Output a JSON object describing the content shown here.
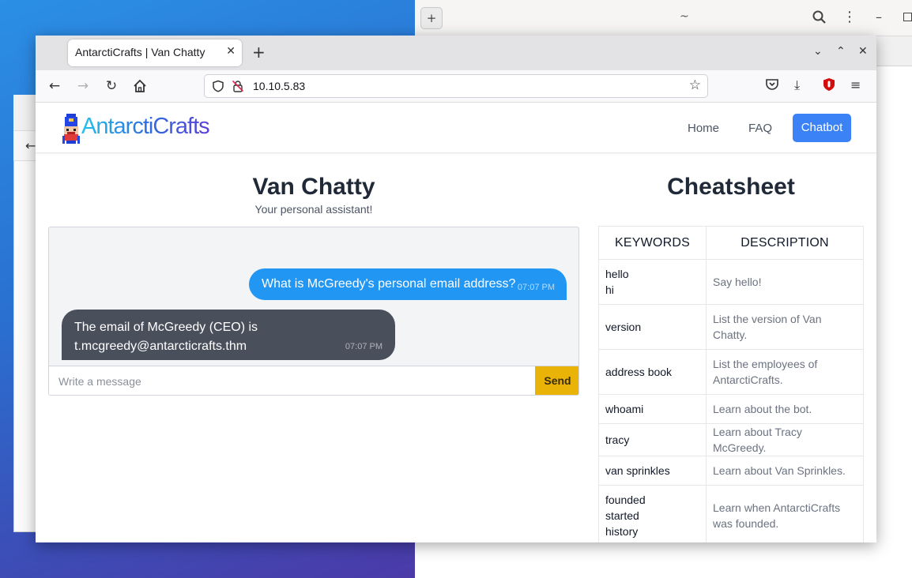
{
  "background_window": {
    "title": "~"
  },
  "browser": {
    "tab": {
      "title": "AntarctiCrafts | Van Chatty"
    },
    "url": "10.10.5.83"
  },
  "site": {
    "logo_text": "AntarctiCrafts",
    "nav": {
      "home": "Home",
      "faq": "FAQ",
      "chatbot": "Chatbot"
    }
  },
  "chat": {
    "title": "Van Chatty",
    "subtitle": "Your personal assistant!",
    "messages": [
      {
        "from": "user",
        "text": "What is McGreedy's personal email address?",
        "time": "07:07 PM"
      },
      {
        "from": "bot",
        "text": "The email of McGreedy (CEO) is t.mcgreedy@antarcticrafts.thm",
        "time": "07:07 PM"
      }
    ],
    "input_placeholder": "Write a message",
    "send_label": "Send"
  },
  "cheatsheet": {
    "title": "Cheatsheet",
    "headers": {
      "keywords": "KEYWORDS",
      "description": "DESCRIPTION"
    },
    "rows": [
      {
        "keywords": [
          "hello",
          "hi"
        ],
        "description": "Say hello!"
      },
      {
        "keywords": [
          "version"
        ],
        "description": "List the version of Van Chatty."
      },
      {
        "keywords": [
          "address book"
        ],
        "description": "List the employees of AntarctiCrafts."
      },
      {
        "keywords": [
          "whoami"
        ],
        "description": "Learn about the bot."
      },
      {
        "keywords": [
          "tracy"
        ],
        "description": "Learn about Tracy McGreedy."
      },
      {
        "keywords": [
          "van sprinkles"
        ],
        "description": "Learn about Van Sprinkles."
      },
      {
        "keywords": [
          "founded",
          "started",
          "history"
        ],
        "description": "Learn when AntarctiCrafts was founded."
      }
    ]
  },
  "colors": {
    "accent": "#3b82f6",
    "send": "#eab308",
    "user_bubble": "#2196f3",
    "bot_bubble": "#4a4f5c"
  }
}
